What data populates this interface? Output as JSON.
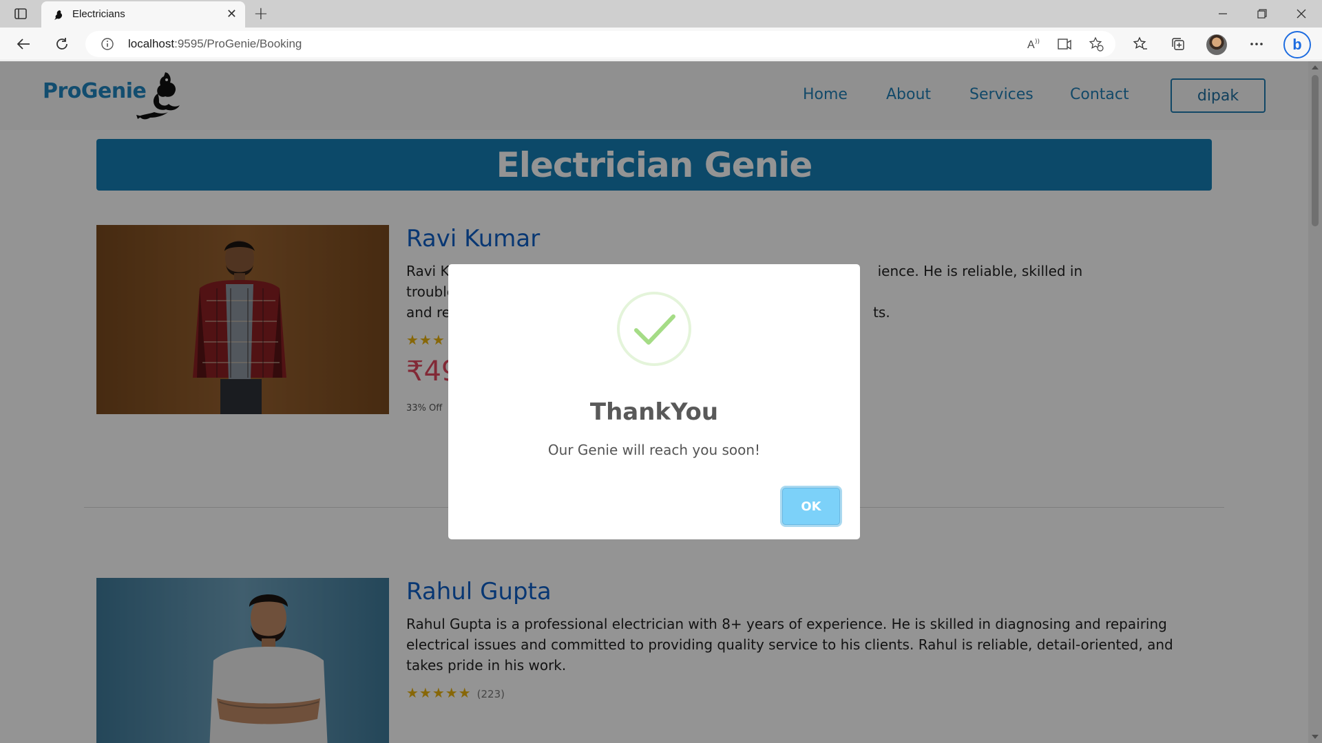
{
  "browser": {
    "tab_title": "Electricians",
    "url_host": "localhost",
    "url_rest": ":9595/ProGenie/Booking"
  },
  "site": {
    "logo": "ProGenie",
    "nav": [
      "Home",
      "About",
      "Services",
      "Contact"
    ],
    "user": "dipak",
    "banner": "Electrician Genie"
  },
  "electricians": [
    {
      "name": "Ravi Kumar",
      "desc_left": "Ravi K",
      "desc_right": "ience. He is reliable, skilled in troubleshooting",
      "desc2_left": "and re",
      "desc2_right": "ts.",
      "stars": "★★★",
      "price": "₹49",
      "discount": "33% Off"
    },
    {
      "name": "Rahul Gupta",
      "description": "Rahul Gupta is a professional electrician with 8+ years of experience. He is skilled in diagnosing and repairing electrical issues and committed to providing quality service to his clients. Rahul is reliable, detail-oriented, and takes pride in his work.",
      "stars": "★★★★★",
      "reviews": "(223)"
    }
  ],
  "modal": {
    "title": "ThankYou",
    "message": "Our Genie will reach you soon!",
    "ok_label": "OK"
  },
  "colors": {
    "brand": "#1f86c0",
    "banner": "#167fb5",
    "name": "#0f5fc7",
    "price": "#e0475d",
    "success": "#a5dc86",
    "ok_button": "#7cd1f9"
  }
}
